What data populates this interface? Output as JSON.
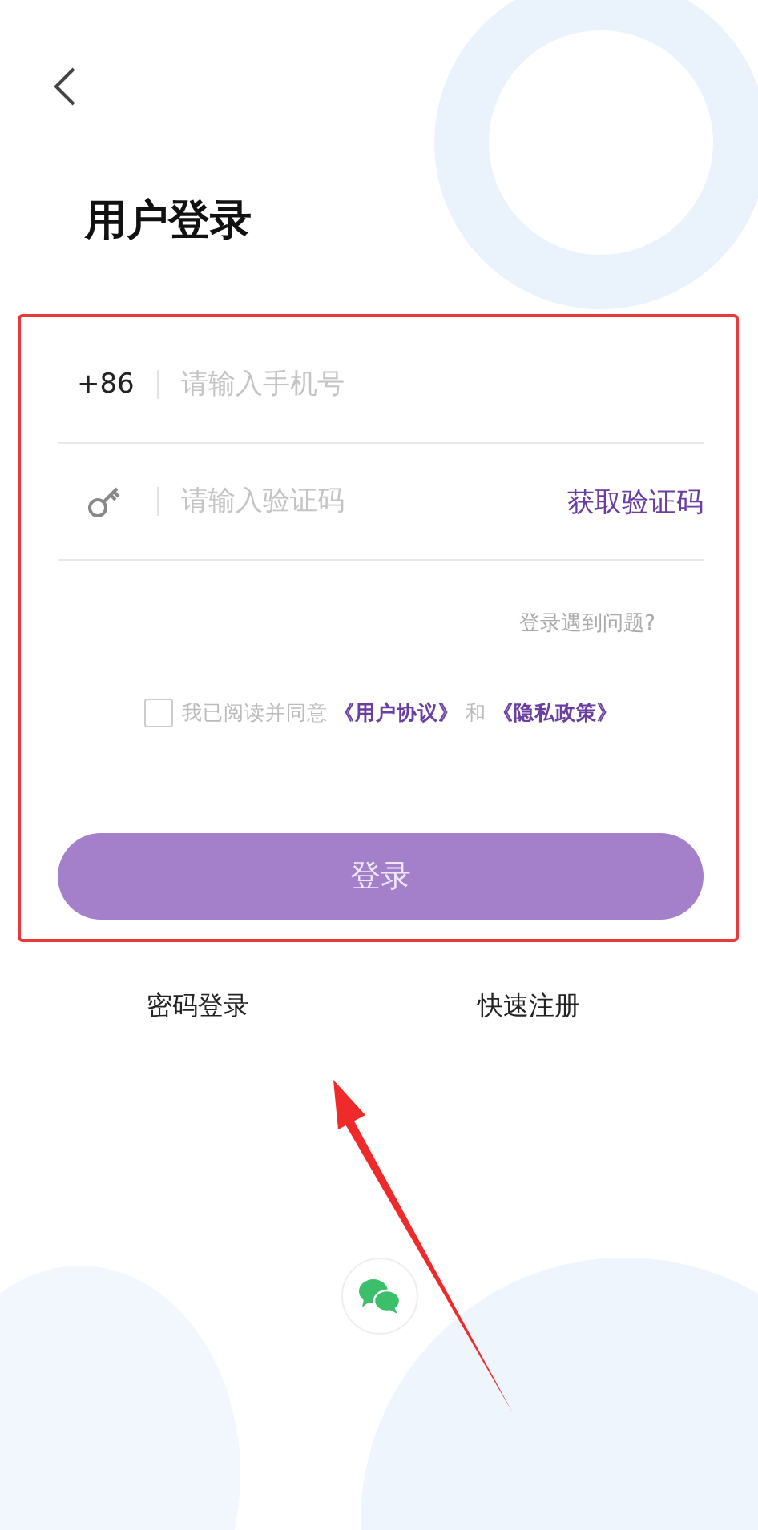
{
  "title": "用户登录",
  "phone": {
    "country_code": "+86",
    "placeholder": "请输入手机号"
  },
  "code": {
    "placeholder": "请输入验证码",
    "get_code_button": "获取验证码"
  },
  "help_link": "登录遇到问题?",
  "agreement": {
    "checked": false,
    "prefix": "我已阅读并同意",
    "links": [
      "《用户协议》",
      "《隐私政策》"
    ],
    "conjunction": "和"
  },
  "login_button": "登录",
  "alt_links": [
    "密码登录",
    "快速注册"
  ]
}
